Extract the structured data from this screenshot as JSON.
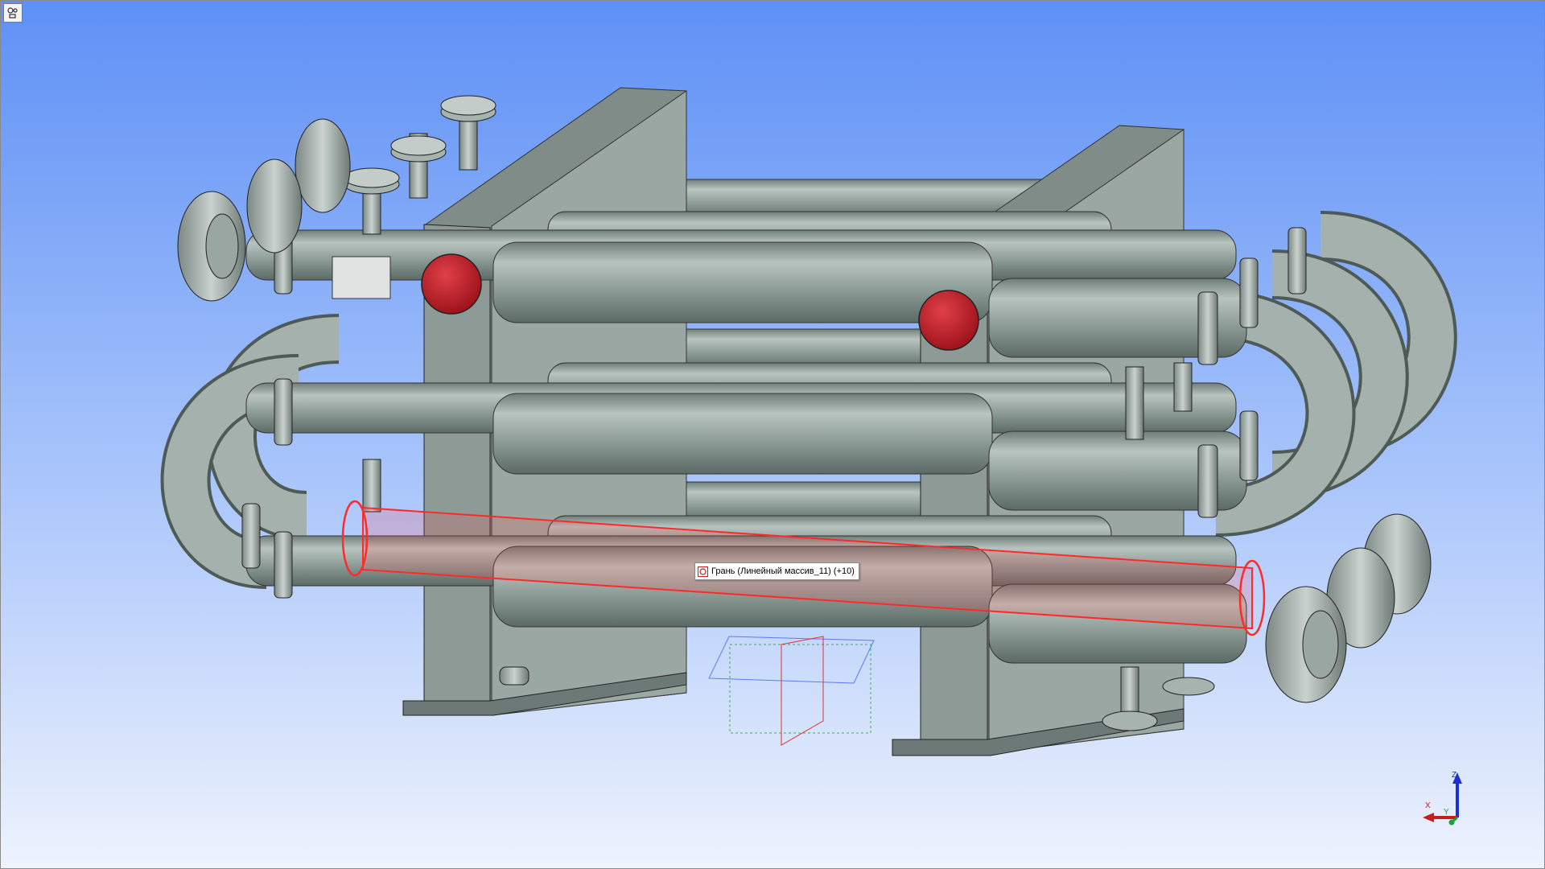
{
  "viewport": {
    "background_top": "#5e90f5",
    "background_bottom": "#eef3fd",
    "corner_button_icon": "view-settings-icon"
  },
  "model": {
    "pipe_color": "#8e9c98",
    "frame_color": "#86928e",
    "cap_color": "#c8202a",
    "highlight_color": "#ff3030"
  },
  "tooltip": {
    "icon": "face-select-icon",
    "text": "Грань (Линейный массив_11) (+10)"
  },
  "triad": {
    "z_label": "Z",
    "x_label": "X",
    "y_label": "Y"
  }
}
